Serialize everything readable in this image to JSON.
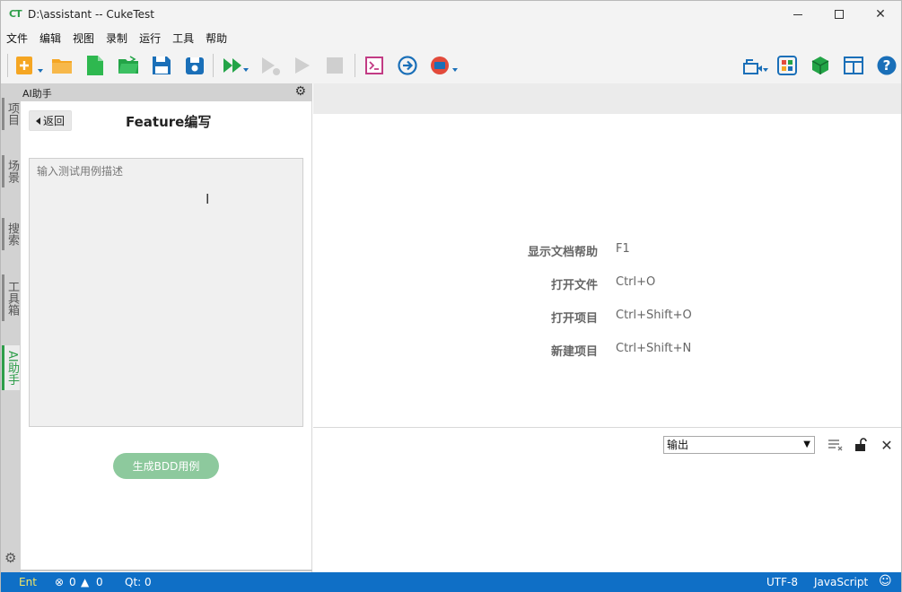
{
  "window": {
    "logo": "CT",
    "title": "D:\\assistant -- CukeTest",
    "controls": {
      "minimize": "—",
      "maximize": "☐",
      "close": "✕"
    }
  },
  "menu": [
    "文件",
    "编辑",
    "视图",
    "录制",
    "运行",
    "工具",
    "帮助"
  ],
  "toolbar": {
    "left": [
      "new-file-icon",
      "open-folder-icon",
      "new-document-icon",
      "open-project-icon",
      "save-icon",
      "save-all-icon",
      "run-all-icon",
      "run-step-icon",
      "run-icon",
      "stop-icon",
      "terminal-icon",
      "goto-icon",
      "record-icon"
    ],
    "right": [
      "recorder-settings-icon",
      "model-manager-icon",
      "package-icon",
      "layout-icon",
      "help-icon"
    ]
  },
  "left_tabs": [
    {
      "label": "项目",
      "active": false
    },
    {
      "label": "场景",
      "active": false
    },
    {
      "label": "搜索",
      "active": false
    },
    {
      "label": "工具箱",
      "active": false
    },
    {
      "label": "AI助手",
      "active": true
    }
  ],
  "ai_panel": {
    "header": "AI助手",
    "back_label": "返回",
    "title": "Feature编写",
    "placeholder": "输入测试用例描述",
    "generate_label": "生成BDD用例"
  },
  "shortcuts": [
    {
      "label": "显示文档帮助",
      "key": "F1"
    },
    {
      "label": "打开文件",
      "key": "Ctrl+O"
    },
    {
      "label": "打开项目",
      "key": "Ctrl+Shift+O"
    },
    {
      "label": "新建项目",
      "key": "Ctrl+Shift+N"
    }
  ],
  "output": {
    "selected": "输出"
  },
  "status": {
    "mode": "Ent",
    "errors": "0",
    "warnings": "0",
    "qt": "Qt: 0",
    "encoding": "UTF-8",
    "language": "JavaScript"
  },
  "colors": {
    "accent_green": "#2e9e4a",
    "statusbar_blue": "#0f6fc6",
    "generate_button": "#8dc99d"
  }
}
